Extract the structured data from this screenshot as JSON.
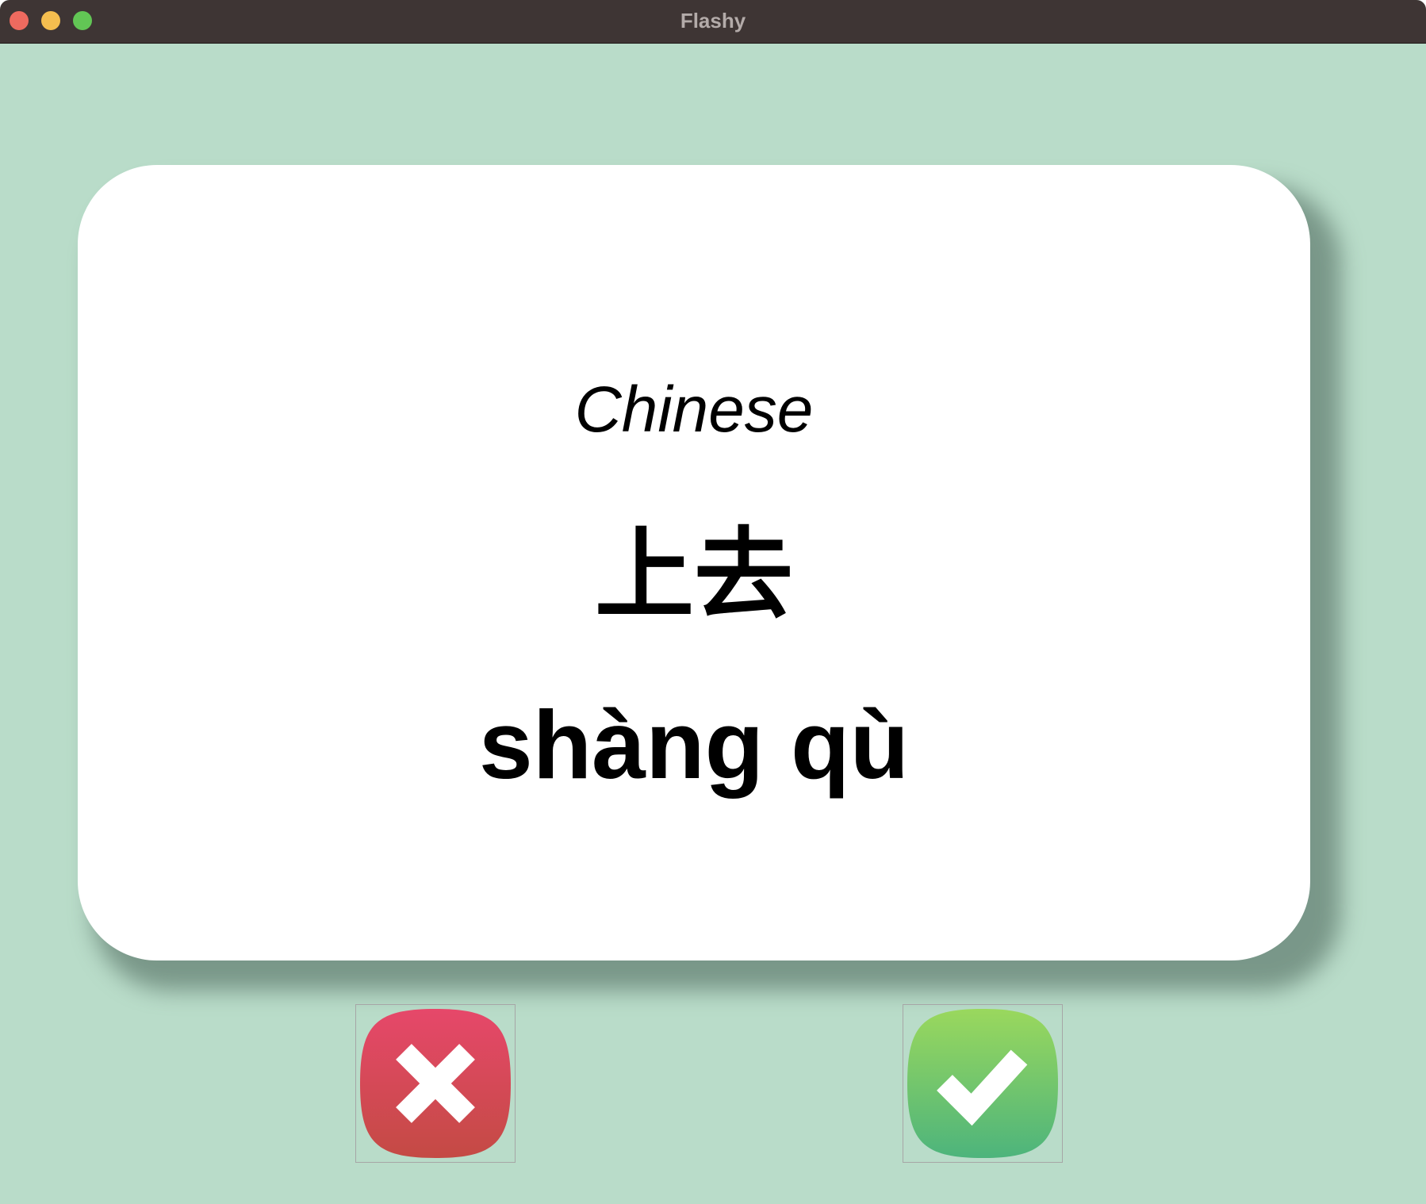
{
  "window": {
    "title": "Flashy"
  },
  "card": {
    "language": "Chinese",
    "word": "上去",
    "pinyin": "shàng qù"
  },
  "buttons": {
    "wrong": {
      "icon": "cross-icon",
      "color_top": "#e6486a",
      "color_bottom": "#c44a44"
    },
    "right": {
      "icon": "check-icon",
      "color_top": "#9ad85d",
      "color_bottom": "#4db47c"
    }
  },
  "colors": {
    "background": "#b9dcc9",
    "card": "#ffffff",
    "titlebar": "#3e3534"
  }
}
